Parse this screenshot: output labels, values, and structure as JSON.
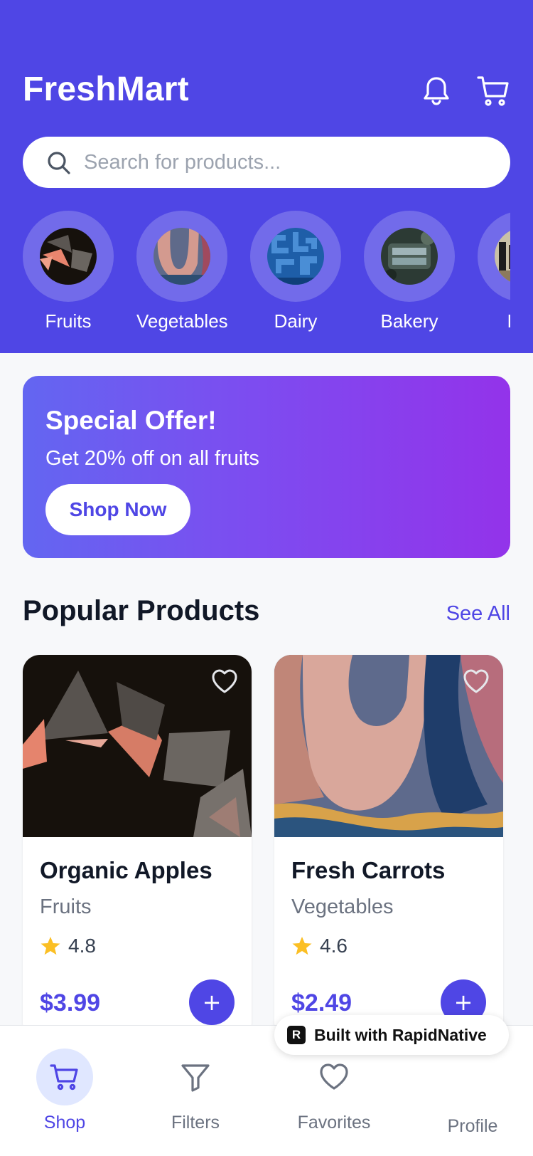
{
  "header": {
    "app_title": "FreshMart",
    "bell_icon": "bell-icon",
    "cart_icon": "cart-icon",
    "brand_color": "#4f46e5"
  },
  "search": {
    "placeholder": "Search for products...",
    "value": ""
  },
  "categories": [
    {
      "label": "Fruits"
    },
    {
      "label": "Vegetables"
    },
    {
      "label": "Dairy"
    },
    {
      "label": "Bakery"
    },
    {
      "label": "Bev"
    }
  ],
  "banner": {
    "title": "Special Offer!",
    "subtitle": "Get 20% off on all fruits",
    "cta_label": "Shop Now"
  },
  "popular": {
    "title": "Popular Products",
    "see_all_label": "See All",
    "products": [
      {
        "name": "Organic Apples",
        "category": "Fruits",
        "rating": "4.8",
        "price": "$3.99",
        "add_label": "+"
      },
      {
        "name": "Fresh Carrots",
        "category": "Vegetables",
        "rating": "4.6",
        "price": "$2.49",
        "add_label": "+"
      }
    ]
  },
  "badge": {
    "built_with": "Built with RapidNative"
  },
  "nav": {
    "items": [
      {
        "label": "Shop",
        "icon": "cart-icon",
        "active": true
      },
      {
        "label": "Filters",
        "icon": "filter-icon",
        "active": false
      },
      {
        "label": "Favorites",
        "icon": "heart-icon",
        "active": false
      },
      {
        "label": "Profile",
        "icon": "user-icon",
        "active": false
      }
    ]
  }
}
